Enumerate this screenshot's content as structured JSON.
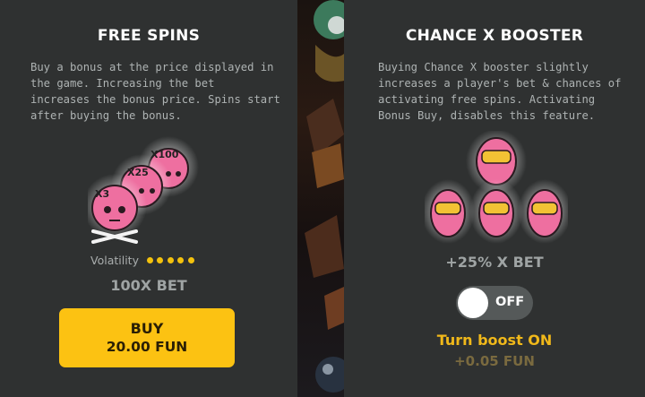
{
  "free_spins": {
    "title": "FREE SPINS",
    "description": "Buy a bonus at the price displayed in\nthe game. Increasing the bet\nincreases the bonus price. Spins start\nafter buying the bonus.",
    "multipliers": [
      "X3",
      "X25",
      "X100"
    ],
    "volatility_label": "Volatility",
    "volatility_level": 5,
    "volatility_max": 5,
    "bet_text": "100X BET",
    "buy_label": "BUY",
    "buy_price": "20.00 FUN"
  },
  "chance_booster": {
    "title": "CHANCE X BOOSTER",
    "description": "Buying Chance X booster slightly\nincreases a player's bet & chances of\nactivating free spins. Activating\nBonus Buy, disables this feature.",
    "bet_text": "+25% X BET",
    "toggle_state": "OFF",
    "turn_on_label": "Turn boost ON",
    "boost_price": "+0.05 FUN"
  },
  "colors": {
    "panel_bg": "#2f3131",
    "accent_yellow": "#fcc212",
    "pink": "#ee6fa0"
  }
}
